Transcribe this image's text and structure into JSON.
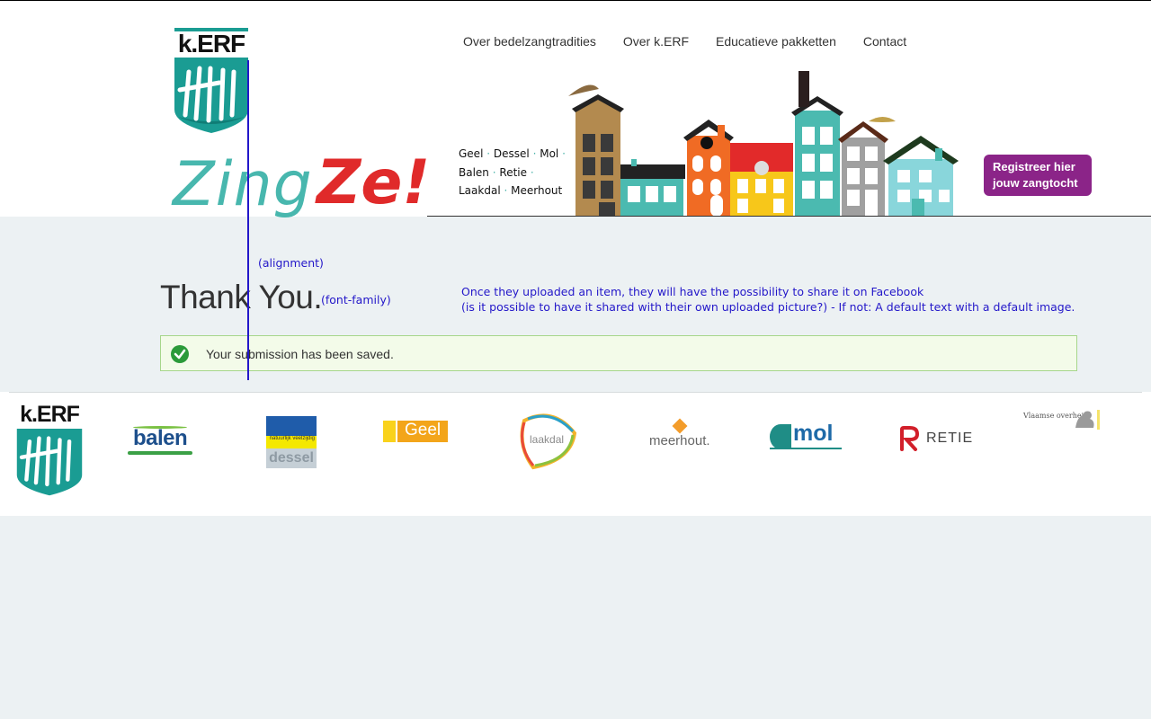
{
  "header": {
    "logo_text": "k.ERF",
    "slogan_word1": "Zing",
    "slogan_word2": "Ze!",
    "nav": [
      {
        "label": "Over bedelzangtradities"
      },
      {
        "label": "Over k.ERF"
      },
      {
        "label": "Educatieve pakketten"
      },
      {
        "label": "Contact"
      }
    ],
    "towns_line1": [
      "Geel",
      "Dessel",
      "Mol"
    ],
    "towns_line2": [
      "Balen",
      "Retie"
    ],
    "towns_line3": [
      "Laakdal",
      "Meerhout"
    ],
    "register_label_1": "Registreer hier",
    "register_label_2": "jouw zangtocht"
  },
  "main": {
    "title": "Thank You.",
    "success_message": "Your submission has been saved."
  },
  "annotations": {
    "alignment": "(alignment)",
    "font_family": "(font-family)",
    "facebook_line1": "Once they uploaded an item, they will have the possibility to share it on Facebook",
    "facebook_line2": "(is it possible to have it shared with their own uploaded picture?) - If not: A default text with a default image."
  },
  "footer": {
    "logo_text": "k.ERF",
    "sponsors": [
      {
        "name": "balen"
      },
      {
        "name": "dessel",
        "tag": "natuurlijk veelzijdig"
      },
      {
        "name": "Geel"
      },
      {
        "name": "laakdal"
      },
      {
        "name": "meerhout."
      },
      {
        "name": "mol"
      },
      {
        "name": "RETIE"
      },
      {
        "name": "Vlaamse overheid"
      }
    ]
  },
  "colors": {
    "teal": "#1a9c93",
    "register_purple": "#8b2488",
    "annotation_blue": "#2317c9",
    "success_bg": "#f3fbe9",
    "success_border": "#a6d68b"
  }
}
